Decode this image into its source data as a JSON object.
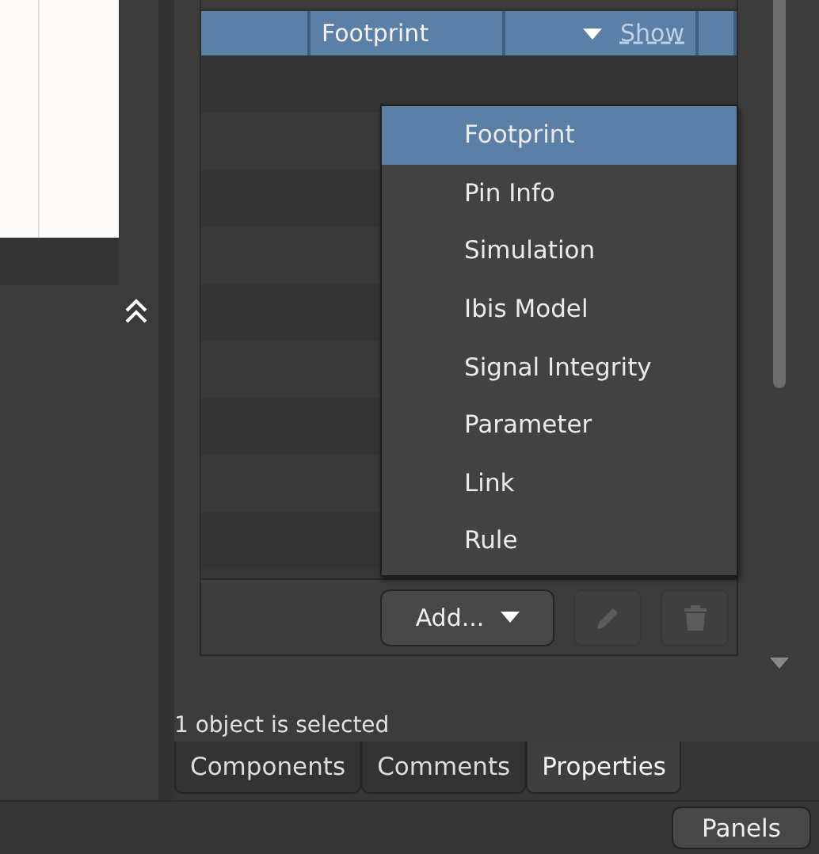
{
  "models_row": {
    "type": "Footprint",
    "link": "Show",
    "selected": true
  },
  "add_menu": [
    {
      "label": "Footprint",
      "selected": true
    },
    {
      "label": "Pin Info",
      "selected": false
    },
    {
      "label": "Simulation",
      "selected": false
    },
    {
      "label": "Ibis Model",
      "selected": false
    },
    {
      "label": "Signal Integrity",
      "selected": false
    },
    {
      "label": "Parameter",
      "selected": false
    },
    {
      "label": "Link",
      "selected": false
    },
    {
      "label": "Rule",
      "selected": false
    }
  ],
  "add_button": "Add...",
  "edit_button": {
    "disabled": true
  },
  "delete_button": {
    "disabled": true
  },
  "status": "1 object is selected",
  "tabs": [
    {
      "label": "Components",
      "selected": false
    },
    {
      "label": "Comments",
      "selected": false
    },
    {
      "label": "Properties",
      "selected": true
    }
  ],
  "panels_button": "Panels"
}
